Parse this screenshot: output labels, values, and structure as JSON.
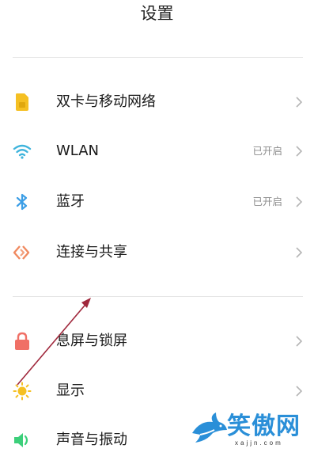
{
  "header": {
    "title": "设置"
  },
  "items": [
    {
      "label": "双卡与移动网络",
      "status": "",
      "icon": "sim-card-icon",
      "color": "#f5c023"
    },
    {
      "label": "WLAN",
      "status": "已开启",
      "icon": "wifi-icon",
      "color": "#3fb4dc"
    },
    {
      "label": "蓝牙",
      "status": "已开启",
      "icon": "bluetooth-icon",
      "color": "#3c9ee6"
    },
    {
      "label": "连接与共享",
      "status": "",
      "icon": "connection-share-icon",
      "color": "#f08a60"
    },
    {
      "label": "息屏与锁屏",
      "status": "",
      "icon": "lock-icon",
      "color": "#f07066"
    },
    {
      "label": "显示",
      "status": "",
      "icon": "sun-icon",
      "color": "#f5c023"
    },
    {
      "label": "声音与振动",
      "status": "",
      "icon": "speaker-icon",
      "color": "#3ccf7a"
    }
  ],
  "watermark": {
    "text": "笑傲网",
    "domain": "xajjn.com"
  },
  "colors": {
    "annotation_arrow": "#a0283c",
    "chevron": "#b5b5b5",
    "status_text": "#8c8c8c"
  }
}
